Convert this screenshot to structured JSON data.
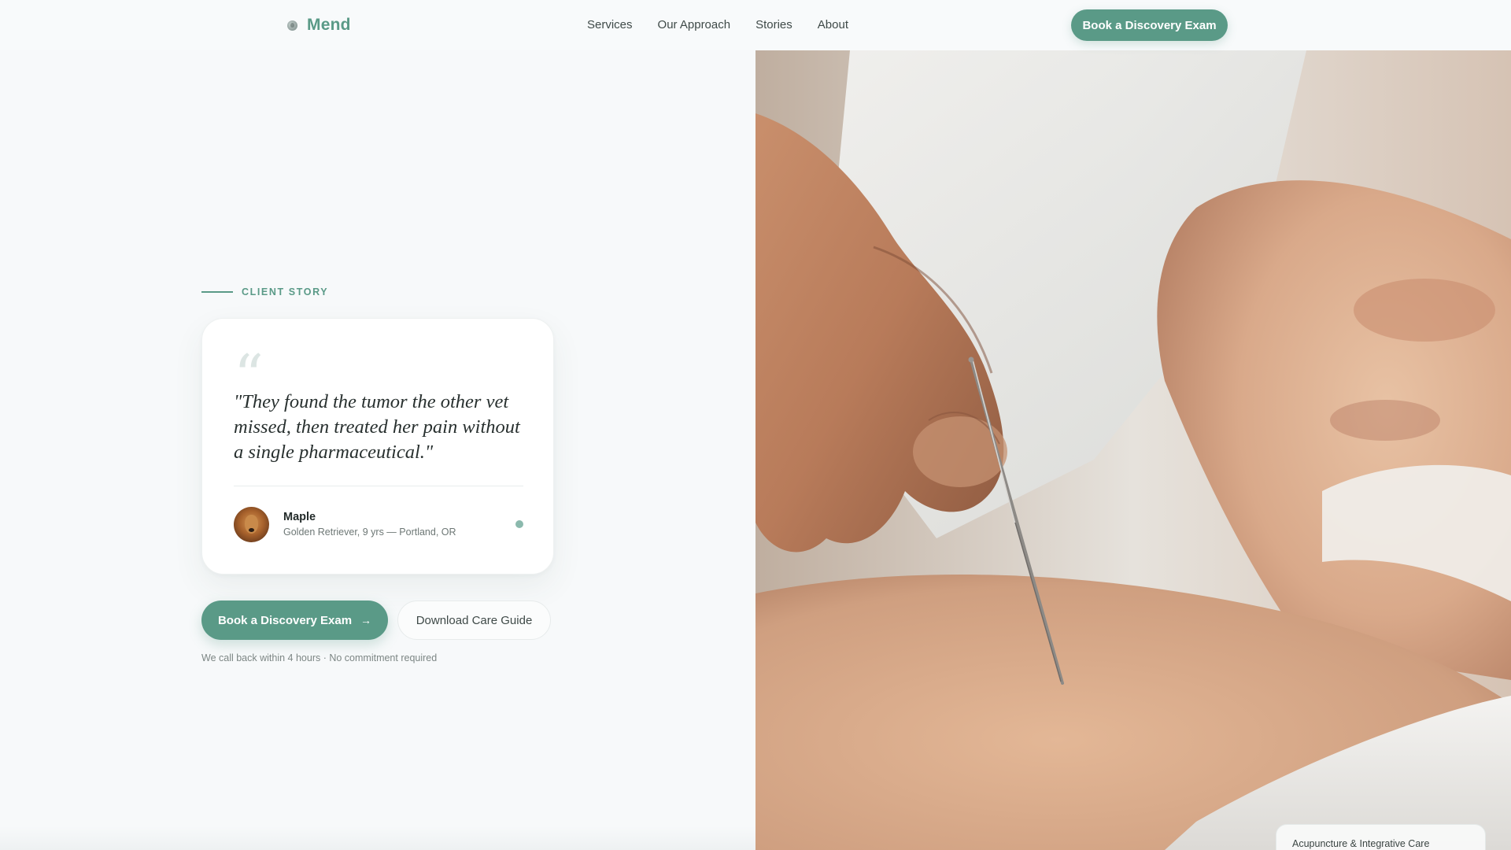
{
  "header": {
    "brand": "Mend",
    "logo_icon": "paw-leaf-logo-icon",
    "nav": [
      {
        "label": "Services"
      },
      {
        "label": "Our Approach"
      },
      {
        "label": "Stories"
      },
      {
        "label": "About"
      }
    ],
    "cta_label": "Book a Discovery Exam"
  },
  "eyebrow": "CLIENT STORY",
  "testimonial": {
    "quote_mark": "“",
    "quote": "\"They found the tumor the other vet missed, then treated her pain without a single pharmaceutical.\"",
    "author_name": "Maple",
    "author_meta": "Golden Retriever, 9 yrs — Portland, OR"
  },
  "actions": {
    "primary_label": "Book a Discovery Exam",
    "primary_icon": "arrow-right-icon",
    "secondary_label": "Download Care Guide"
  },
  "reassurance": "We call back within 4 hours · No commitment required",
  "hero": {
    "badge": "Acupuncture & Integrative Care"
  },
  "colors": {
    "accent": "#5a9a87",
    "background": "#f7f9fa",
    "text": "#28302f"
  }
}
